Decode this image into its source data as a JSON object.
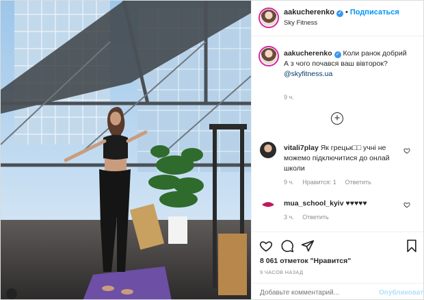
{
  "post": {
    "username": "aakucherenko",
    "separator": "•",
    "follow_label": "Подписаться",
    "location": "Sky Fitness",
    "caption_text": "Коли ранок добрий",
    "caption_line2": "А з чого почався ваш вівторок?",
    "caption_mention": "@skyfitness.ua",
    "caption_time": "9 ч."
  },
  "comments": [
    {
      "username": "vitali7play",
      "text": "Як грецьк□□ учні не можемо підключитися до онлай школи",
      "time": "9 ч.",
      "likes_label": "Нравится: 1",
      "reply_label": "Ответить"
    },
    {
      "username": "mua_school_kyiv",
      "text": "♥♥♥♥♥",
      "time": "3 ч.",
      "reply_label": "Ответить"
    }
  ],
  "stats": {
    "likes_text": "8 061 отметок \"Нравится\"",
    "posted_ago": "9 ЧАСОВ НАЗАД"
  },
  "composer": {
    "placeholder": "Добавьте комментарий...",
    "publish_label": "Опубликовать"
  },
  "icons": {
    "verified": "verified-badge-icon",
    "like": "heart-icon",
    "comment": "comment-bubble-icon",
    "share": "paper-plane-icon",
    "save": "bookmark-icon",
    "add": "plus-circle-icon"
  },
  "colors": {
    "follow": "#0095f6",
    "verified": "#3897f0",
    "link": "#00376b",
    "muted": "#8e8e8e"
  }
}
